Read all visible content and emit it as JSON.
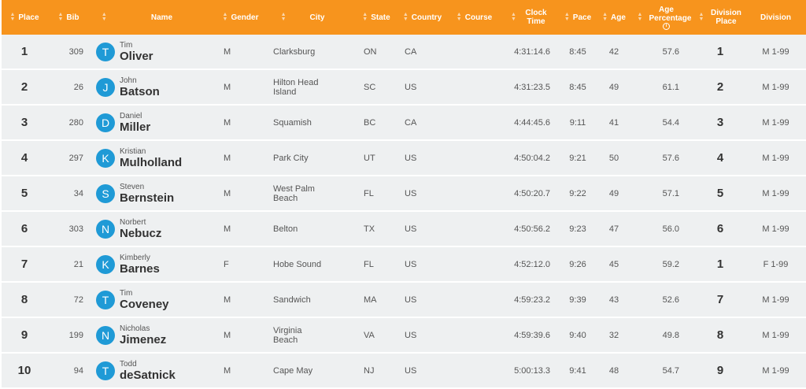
{
  "headers": {
    "place": "Place",
    "bib": "Bib",
    "name": "Name",
    "gender": "Gender",
    "city": "City",
    "state": "State",
    "country": "Country",
    "course": "Course",
    "clock_time": "Clock Time",
    "pace": "Pace",
    "age": "Age",
    "age_percentage": "Age Percentage",
    "division_place": "Division Place",
    "division": "Division"
  },
  "rows": [
    {
      "place": "1",
      "bib": "309",
      "initial": "T",
      "first": "Tim",
      "last": "Oliver",
      "gender": "M",
      "city": "Clarksburg",
      "state": "ON",
      "country": "CA",
      "clock": "4:31:14.6",
      "pace": "8:45",
      "age": "42",
      "agep": "57.6",
      "dplace": "1",
      "division": "M 1-99"
    },
    {
      "place": "2",
      "bib": "26",
      "initial": "J",
      "first": "John",
      "last": "Batson",
      "gender": "M",
      "city": "Hilton Head Island",
      "state": "SC",
      "country": "US",
      "clock": "4:31:23.5",
      "pace": "8:45",
      "age": "49",
      "agep": "61.1",
      "dplace": "2",
      "division": "M 1-99"
    },
    {
      "place": "3",
      "bib": "280",
      "initial": "D",
      "first": "Daniel",
      "last": "Miller",
      "gender": "M",
      "city": "Squamish",
      "state": "BC",
      "country": "CA",
      "clock": "4:44:45.6",
      "pace": "9:11",
      "age": "41",
      "agep": "54.4",
      "dplace": "3",
      "division": "M 1-99"
    },
    {
      "place": "4",
      "bib": "297",
      "initial": "K",
      "first": "Kristian",
      "last": "Mulholland",
      "gender": "M",
      "city": "Park City",
      "state": "UT",
      "country": "US",
      "clock": "4:50:04.2",
      "pace": "9:21",
      "age": "50",
      "agep": "57.6",
      "dplace": "4",
      "division": "M 1-99"
    },
    {
      "place": "5",
      "bib": "34",
      "initial": "S",
      "first": "Steven",
      "last": "Bernstein",
      "gender": "M",
      "city": "West Palm Beach",
      "state": "FL",
      "country": "US",
      "clock": "4:50:20.7",
      "pace": "9:22",
      "age": "49",
      "agep": "57.1",
      "dplace": "5",
      "division": "M 1-99"
    },
    {
      "place": "6",
      "bib": "303",
      "initial": "N",
      "first": "Norbert",
      "last": "Nebucz",
      "gender": "M",
      "city": "Belton",
      "state": "TX",
      "country": "US",
      "clock": "4:50:56.2",
      "pace": "9:23",
      "age": "47",
      "agep": "56.0",
      "dplace": "6",
      "division": "M 1-99"
    },
    {
      "place": "7",
      "bib": "21",
      "initial": "K",
      "first": "Kimberly",
      "last": "Barnes",
      "gender": "F",
      "city": "Hobe Sound",
      "state": "FL",
      "country": "US",
      "clock": "4:52:12.0",
      "pace": "9:26",
      "age": "45",
      "agep": "59.2",
      "dplace": "1",
      "division": "F 1-99"
    },
    {
      "place": "8",
      "bib": "72",
      "initial": "T",
      "first": "Tim",
      "last": "Coveney",
      "gender": "M",
      "city": "Sandwich",
      "state": "MA",
      "country": "US",
      "clock": "4:59:23.2",
      "pace": "9:39",
      "age": "43",
      "agep": "52.6",
      "dplace": "7",
      "division": "M 1-99"
    },
    {
      "place": "9",
      "bib": "199",
      "initial": "N",
      "first": "Nicholas",
      "last": "Jimenez",
      "gender": "M",
      "city": "Virginia Beach",
      "state": "VA",
      "country": "US",
      "clock": "4:59:39.6",
      "pace": "9:40",
      "age": "32",
      "agep": "49.8",
      "dplace": "8",
      "division": "M 1-99"
    },
    {
      "place": "10",
      "bib": "94",
      "initial": "T",
      "first": "Todd",
      "last": "deSatnick",
      "gender": "M",
      "city": "Cape May",
      "state": "NJ",
      "country": "US",
      "clock": "5:00:13.3",
      "pace": "9:41",
      "age": "48",
      "agep": "54.7",
      "dplace": "9",
      "division": "M 1-99"
    }
  ],
  "colors": {
    "header_bg": "#f7941d",
    "avatar_bg": "#1f9ad6",
    "row_bg": "#eef0f1"
  },
  "icons": {
    "sort": "sort-icon",
    "info": "info-icon"
  }
}
